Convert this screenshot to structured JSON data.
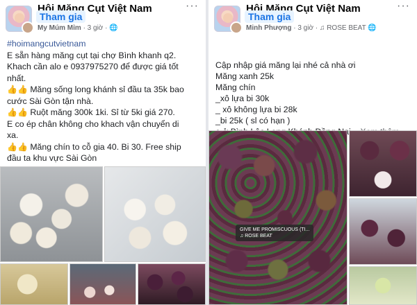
{
  "posts": [
    {
      "group_name": "Hội Măng Cụt Việt Nam",
      "join_label": "Tham gia",
      "author": "My Múm Mỉm",
      "time": "· 3 giờ ·",
      "more_icon": "···",
      "lines": [
        "#hoimangcutvietnam",
        "E sẵn hàng măng cụt tại chợ Bình khanh q2.",
        "Khach cần alo e 0937975270 để được giá tốt",
        "nhất.",
        "Măng sống long khánh sỉ đầu ta 35k bao",
        "cước Sài Gòn tận nhà.",
        "Ruột măng 300k 1ki. Sỉ từ 5ki giá 270.",
        "E co ép chân không cho khach vận chuyển di",
        "xa.",
        "Măng chín to cỗ gia 40. Bi 30. Free ship",
        "đầu ta khu vực Sài Gòn"
      ]
    },
    {
      "group_name": "Hội Măng Cụt Việt Nam",
      "join_label": "Tham gia",
      "author": "Minh Phượng",
      "time": "· 3 giờ ·",
      "music": "♫ ROSE BEAT",
      "more_icon": "···",
      "lines": [
        "Cập nhập giá măng lại nhé cả nhà ơi",
        " Măng xanh 25k",
        "Măng chín",
        "_xô lựa bi 30k",
        "_ xô không lựa bi 28k",
        "_bi 25k ( sl có hạn )",
        "e ở Bình Lộc Long Khánh Đồng Nai..."
      ],
      "see_more": "Xem thêm",
      "music_tag_line1": "GIVE ME PROMISCUOUS (TI...",
      "music_tag_line2": "♫ ROSE BEAT"
    }
  ],
  "icons": [
    "thumbs-up-icon",
    "globe-icon",
    "more-options-icon",
    "music-note-icon"
  ]
}
